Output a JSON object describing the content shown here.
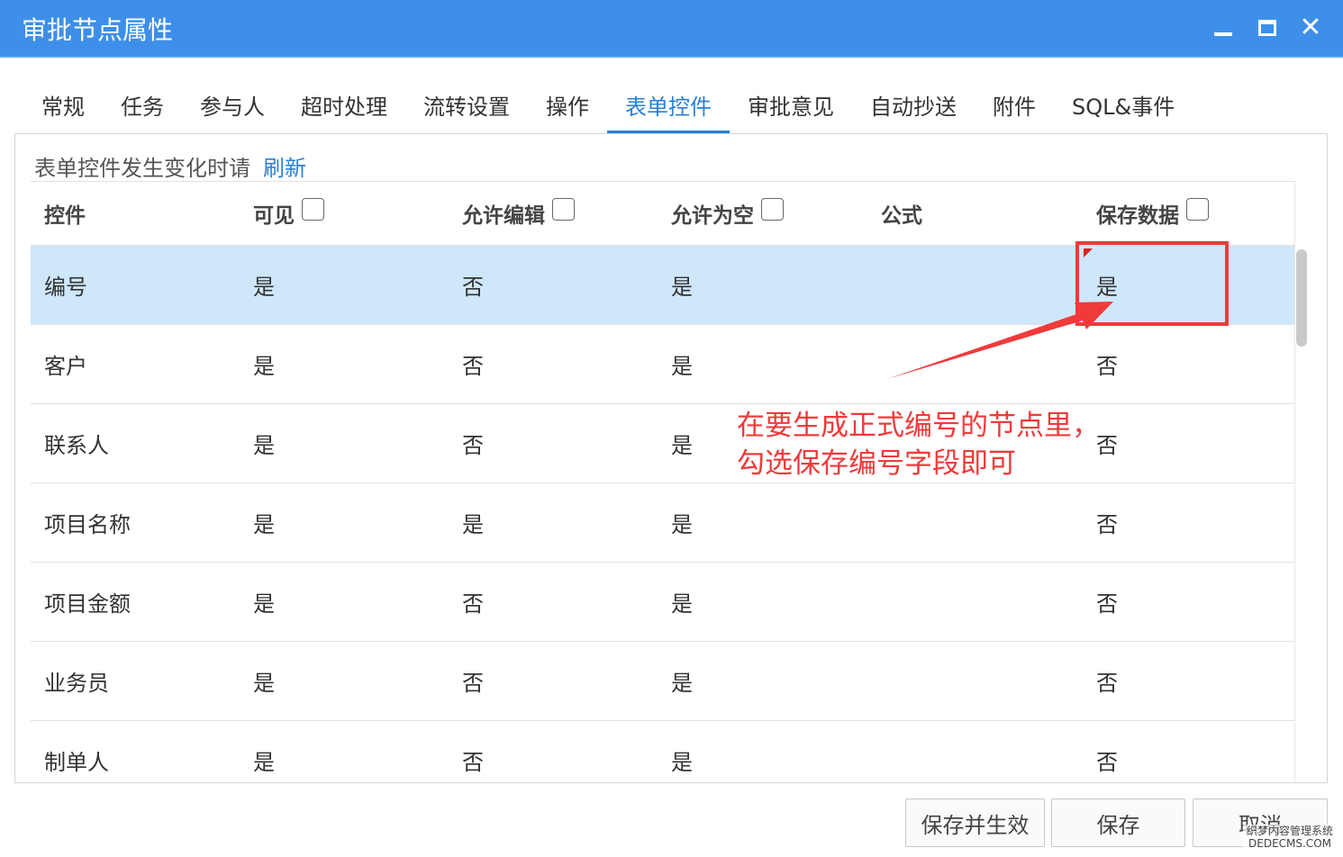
{
  "window": {
    "title": "审批节点属性",
    "accent_color": "#3d8fe9",
    "controls": {
      "minimize_icon": "minimize-icon",
      "maximize_icon": "maximize-icon",
      "close_icon": "close-icon",
      "close_glyph": "✕"
    }
  },
  "tabs": [
    {
      "label": "常规"
    },
    {
      "label": "任务"
    },
    {
      "label": "参与人"
    },
    {
      "label": "超时处理"
    },
    {
      "label": "流转设置"
    },
    {
      "label": "操作"
    },
    {
      "label": "表单控件",
      "active": true
    },
    {
      "label": "审批意见"
    },
    {
      "label": "自动抄送"
    },
    {
      "label": "附件"
    },
    {
      "label": "SQL&事件"
    }
  ],
  "note": {
    "text": "表单控件发生变化时请",
    "refresh_label": "刷新"
  },
  "table": {
    "headers": [
      "控件",
      "可见",
      "允许编辑",
      "允许为空",
      "公式",
      "保存数据"
    ],
    "header_checkboxes": {
      "可见": false,
      "允许编辑": false,
      "允许为空": false,
      "保存数据": false
    },
    "rows": [
      {
        "cells": [
          "编号",
          "是",
          "否",
          "是",
          "",
          "是"
        ],
        "selected": true
      },
      {
        "cells": [
          "客户",
          "是",
          "否",
          "是",
          "",
          "否"
        ]
      },
      {
        "cells": [
          "联系人",
          "是",
          "否",
          "是",
          "",
          "否"
        ]
      },
      {
        "cells": [
          "项目名称",
          "是",
          "是",
          "是",
          "",
          "否"
        ]
      },
      {
        "cells": [
          "项目金额",
          "是",
          "否",
          "是",
          "",
          "否"
        ]
      },
      {
        "cells": [
          "业务员",
          "是",
          "否",
          "是",
          "",
          "否"
        ]
      },
      {
        "cells": [
          "制单人",
          "是",
          "否",
          "是",
          "",
          "否"
        ]
      }
    ]
  },
  "annotation": {
    "line1": "在要生成正式编号的节点里，",
    "line2": "勾选保存编号字段即可",
    "color": "#f03a3a"
  },
  "buttons": {
    "save_apply": "保存并生效",
    "save": "保存",
    "cancel": "取消"
  },
  "watermark": {
    "line1": "织梦内容管理系统",
    "line2": "DEDECMS.COM"
  }
}
